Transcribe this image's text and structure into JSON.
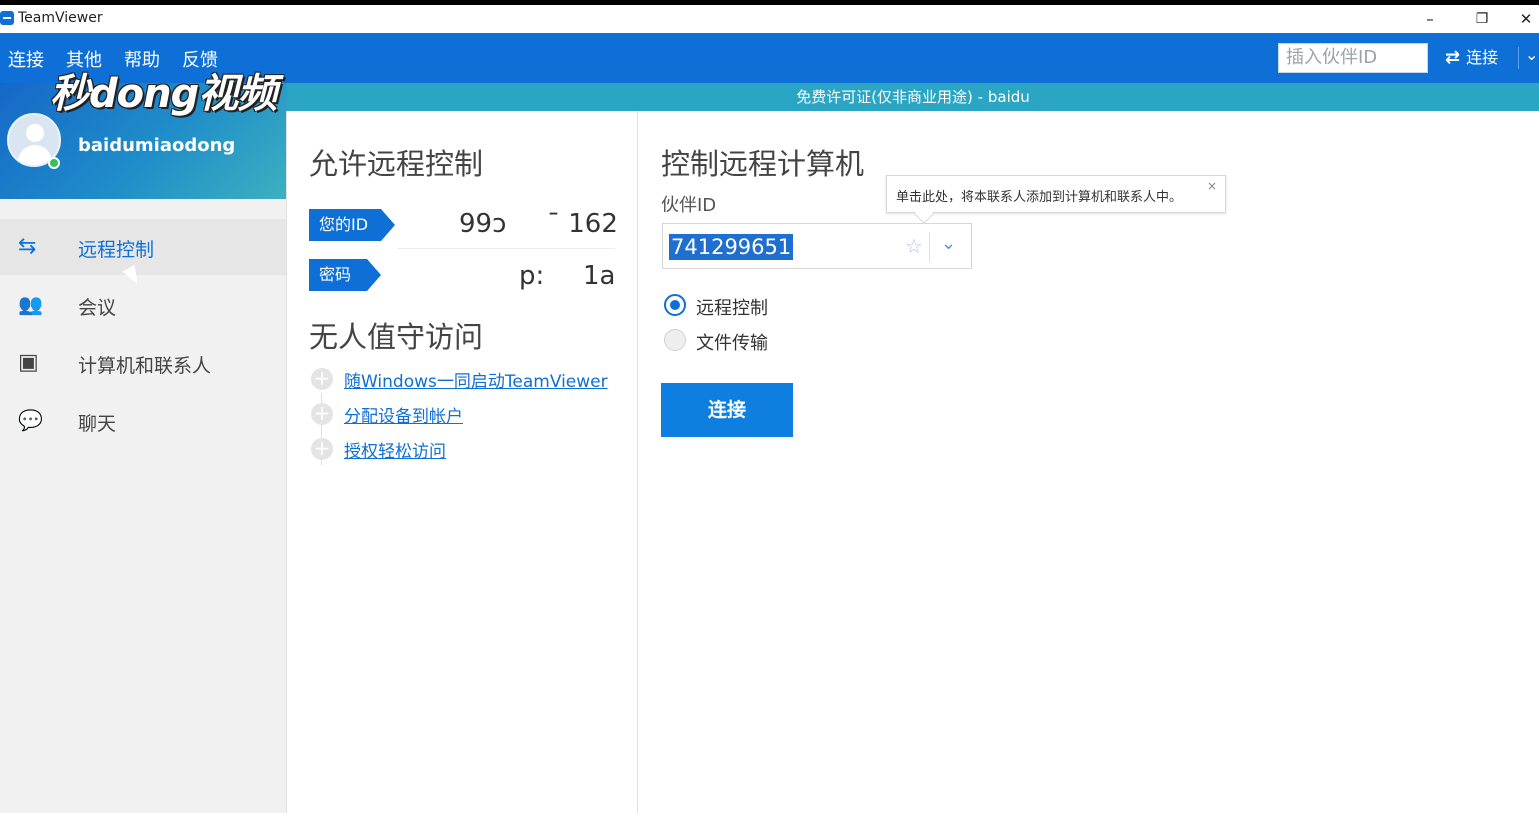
{
  "window": {
    "title": "TeamViewer",
    "minimize": "–",
    "restore": "❐",
    "close": "✕"
  },
  "menu": {
    "items": [
      "连接",
      "其他",
      "帮助",
      "反馈"
    ]
  },
  "topbar": {
    "search_placeholder": "插入伙伴ID",
    "connect_label": "连接",
    "connect_icon": "⇄",
    "dropdown_icon": "⌄"
  },
  "license_banner": "免费许可证(仅非商业用途) - baidu",
  "watermark": "秒dong视频",
  "profile": {
    "username": "baidumiaodong"
  },
  "sidebar": {
    "items": [
      {
        "label": "远程控制",
        "icon": "⇆",
        "active": true
      },
      {
        "label": "会议",
        "icon": "👥",
        "active": false
      },
      {
        "label": "计算机和联系人",
        "icon": "▣",
        "active": false
      },
      {
        "label": "聊天",
        "icon": "💬",
        "active": false
      }
    ]
  },
  "allow_remote": {
    "title": "允许远程控制",
    "id_tag": "您的ID",
    "id_value_left": "99ↄ",
    "id_value_right": "ˉ 162",
    "password_tag": "密码",
    "password_value_left": "p:",
    "password_value_right": "1a"
  },
  "unattended": {
    "title": "无人值守访问",
    "links": [
      "随Windows一同启动TeamViewer",
      "分配设备到帐户",
      "授权轻松访问"
    ]
  },
  "control_remote": {
    "title": "控制远程计算机",
    "partner_label": "伙伴ID",
    "partner_value": "741299651",
    "star_icon": "☆",
    "chevron_icon": "⌄",
    "radio_remote": "远程控制",
    "radio_file": "文件传输",
    "connect_button": "连接",
    "tooltip": "单击此处，将本联系人添加到计算机和联系人中。",
    "tooltip_close": "×"
  }
}
